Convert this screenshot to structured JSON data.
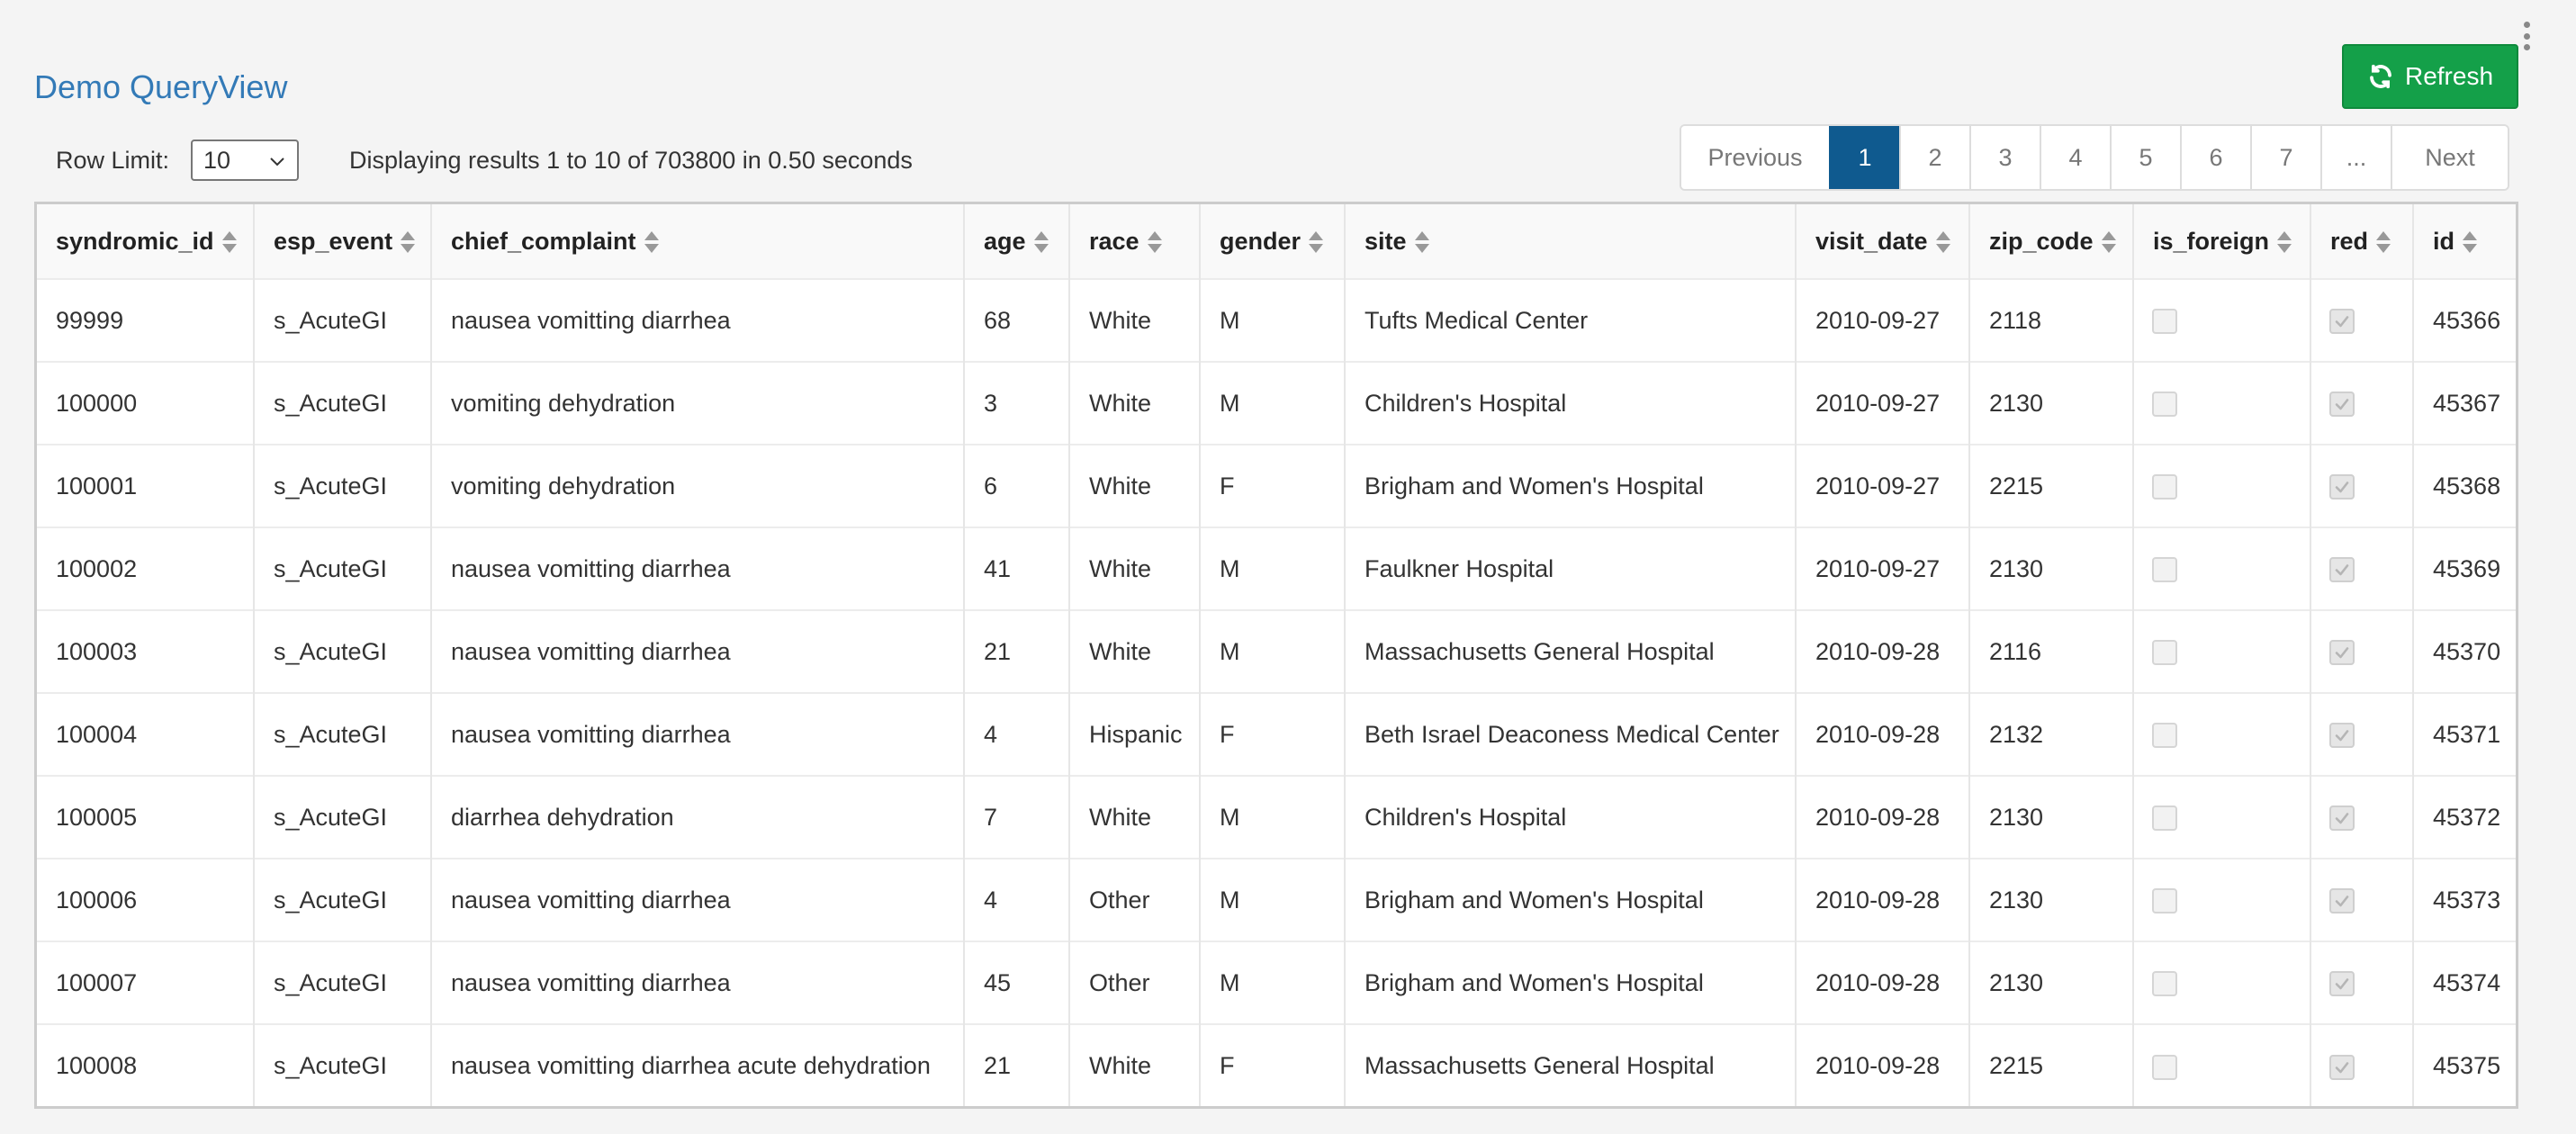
{
  "app": {
    "title": "Demo QueryView"
  },
  "toolbar": {
    "refresh_label": "Refresh",
    "refresh_icon": "refresh-icon"
  },
  "row_limit": {
    "label": "Row Limit:",
    "value": "10"
  },
  "status_text": "Displaying results 1 to 10 of 703800 in 0.50 seconds",
  "pagination": {
    "previous": "Previous",
    "next": "Next",
    "pages": [
      "1",
      "2",
      "3",
      "4",
      "5",
      "6",
      "7",
      "..."
    ],
    "active": "1"
  },
  "table": {
    "columns": [
      "syndromic_id",
      "esp_event",
      "chief_complaint",
      "age",
      "race",
      "gender",
      "site",
      "visit_date",
      "zip_code",
      "is_foreign",
      "red",
      "id"
    ],
    "rows": [
      {
        "syndromic_id": "99999",
        "esp_event": "s_AcuteGI",
        "chief_complaint": "nausea vomitting diarrhea",
        "age": "68",
        "race": "White",
        "gender": "M",
        "site": "Tufts Medical Center",
        "visit_date": "2010-09-27",
        "zip_code": "2118",
        "is_foreign": false,
        "red": true,
        "id": "45366"
      },
      {
        "syndromic_id": "100000",
        "esp_event": "s_AcuteGI",
        "chief_complaint": "vomiting dehydration",
        "age": "3",
        "race": "White",
        "gender": "M",
        "site": "Children's Hospital",
        "visit_date": "2010-09-27",
        "zip_code": "2130",
        "is_foreign": false,
        "red": true,
        "id": "45367"
      },
      {
        "syndromic_id": "100001",
        "esp_event": "s_AcuteGI",
        "chief_complaint": "vomiting dehydration",
        "age": "6",
        "race": "White",
        "gender": "F",
        "site": "Brigham and Women's Hospital",
        "visit_date": "2010-09-27",
        "zip_code": "2215",
        "is_foreign": false,
        "red": true,
        "id": "45368"
      },
      {
        "syndromic_id": "100002",
        "esp_event": "s_AcuteGI",
        "chief_complaint": "nausea vomitting diarrhea",
        "age": "41",
        "race": "White",
        "gender": "M",
        "site": "Faulkner Hospital",
        "visit_date": "2010-09-27",
        "zip_code": "2130",
        "is_foreign": false,
        "red": true,
        "id": "45369"
      },
      {
        "syndromic_id": "100003",
        "esp_event": "s_AcuteGI",
        "chief_complaint": "nausea vomitting diarrhea",
        "age": "21",
        "race": "White",
        "gender": "M",
        "site": "Massachusetts General Hospital",
        "visit_date": "2010-09-28",
        "zip_code": "2116",
        "is_foreign": false,
        "red": true,
        "id": "45370"
      },
      {
        "syndromic_id": "100004",
        "esp_event": "s_AcuteGI",
        "chief_complaint": "nausea vomitting diarrhea",
        "age": "4",
        "race": "Hispanic",
        "gender": "F",
        "site": "Beth Israel Deaconess Medical Center",
        "visit_date": "2010-09-28",
        "zip_code": "2132",
        "is_foreign": false,
        "red": true,
        "id": "45371"
      },
      {
        "syndromic_id": "100005",
        "esp_event": "s_AcuteGI",
        "chief_complaint": "diarrhea dehydration",
        "age": "7",
        "race": "White",
        "gender": "M",
        "site": "Children's Hospital",
        "visit_date": "2010-09-28",
        "zip_code": "2130",
        "is_foreign": false,
        "red": true,
        "id": "45372"
      },
      {
        "syndromic_id": "100006",
        "esp_event": "s_AcuteGI",
        "chief_complaint": "nausea vomitting diarrhea",
        "age": "4",
        "race": "Other",
        "gender": "M",
        "site": "Brigham and Women's Hospital",
        "visit_date": "2010-09-28",
        "zip_code": "2130",
        "is_foreign": false,
        "red": true,
        "id": "45373"
      },
      {
        "syndromic_id": "100007",
        "esp_event": "s_AcuteGI",
        "chief_complaint": "nausea vomitting diarrhea",
        "age": "45",
        "race": "Other",
        "gender": "M",
        "site": "Brigham and Women's Hospital",
        "visit_date": "2010-09-28",
        "zip_code": "2130",
        "is_foreign": false,
        "red": true,
        "id": "45374"
      },
      {
        "syndromic_id": "100008",
        "esp_event": "s_AcuteGI",
        "chief_complaint": "nausea vomitting diarrhea acute dehydration",
        "age": "21",
        "race": "White",
        "gender": "F",
        "site": "Massachusetts General Hospital",
        "visit_date": "2010-09-28",
        "zip_code": "2215",
        "is_foreign": false,
        "red": true,
        "id": "45375"
      }
    ]
  },
  "colors": {
    "title": "#337ab7",
    "refresh_bg": "#14a049",
    "page_active_bg": "#0f5a8f"
  }
}
